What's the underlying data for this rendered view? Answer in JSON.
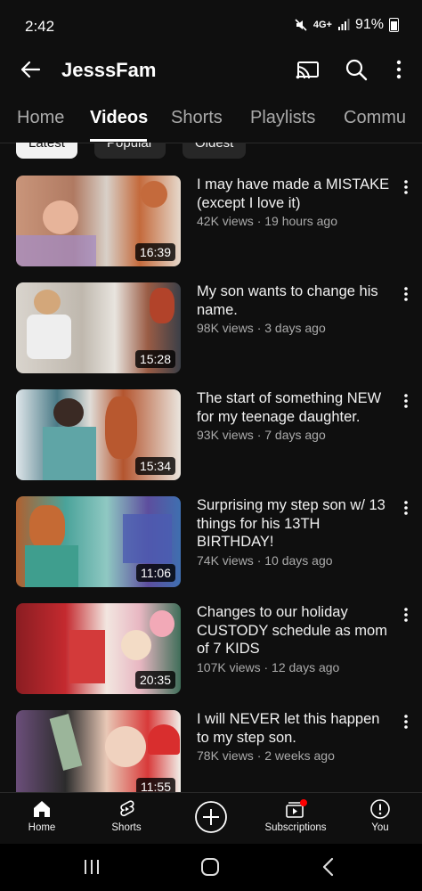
{
  "status_bar": {
    "time": "2:42",
    "network": "4G+",
    "battery": "91%"
  },
  "header": {
    "channel_name": "JesssFam",
    "icons": [
      "back-arrow-icon",
      "cast-icon",
      "search-icon",
      "more-vert-icon"
    ]
  },
  "tabs": [
    {
      "label": "Home",
      "active": false
    },
    {
      "label": "Videos",
      "active": true
    },
    {
      "label": "Shorts",
      "active": false
    },
    {
      "label": "Playlists",
      "active": false
    },
    {
      "label": "Commu",
      "active": false
    }
  ],
  "chips": [
    {
      "label": "Latest",
      "selected": true
    },
    {
      "label": "Popular",
      "selected": false
    },
    {
      "label": "Oldest",
      "selected": false
    }
  ],
  "videos": [
    {
      "title": "I may have made a MISTAKE (except I love it)",
      "meta": "42K views · 19 hours ago",
      "duration": "16:39"
    },
    {
      "title": "My son wants to change his name.",
      "meta": "98K views · 3 days ago",
      "duration": "15:28"
    },
    {
      "title": "The start of something NEW for my teenage daughter.",
      "meta": "93K views · 7 days ago",
      "duration": "15:34"
    },
    {
      "title": "Surprising my step son w/ 13 things for his 13TH BIRTHDAY!",
      "meta": "74K views · 10 days ago",
      "duration": "11:06"
    },
    {
      "title": "Changes to our holiday CUSTODY schedule as mom of 7 KIDS",
      "meta": "107K views · 12 days ago",
      "duration": "20:35"
    },
    {
      "title": "I will NEVER let this happen to my step son.",
      "meta": "78K views · 2 weeks ago",
      "duration": "11:55"
    }
  ],
  "bottom_nav": [
    {
      "label": "Home",
      "icon": "home-icon"
    },
    {
      "label": "Shorts",
      "icon": "shorts-icon"
    },
    {
      "label": "",
      "icon": "create-plus-icon"
    },
    {
      "label": "Subscriptions",
      "icon": "subscriptions-icon"
    },
    {
      "label": "You",
      "icon": "you-icon"
    }
  ],
  "colors": {
    "background": "#0f0f0f",
    "text": "#f1f1f1",
    "secondary_text": "#aaaaaa",
    "notification_dot": "#ff0000"
  }
}
